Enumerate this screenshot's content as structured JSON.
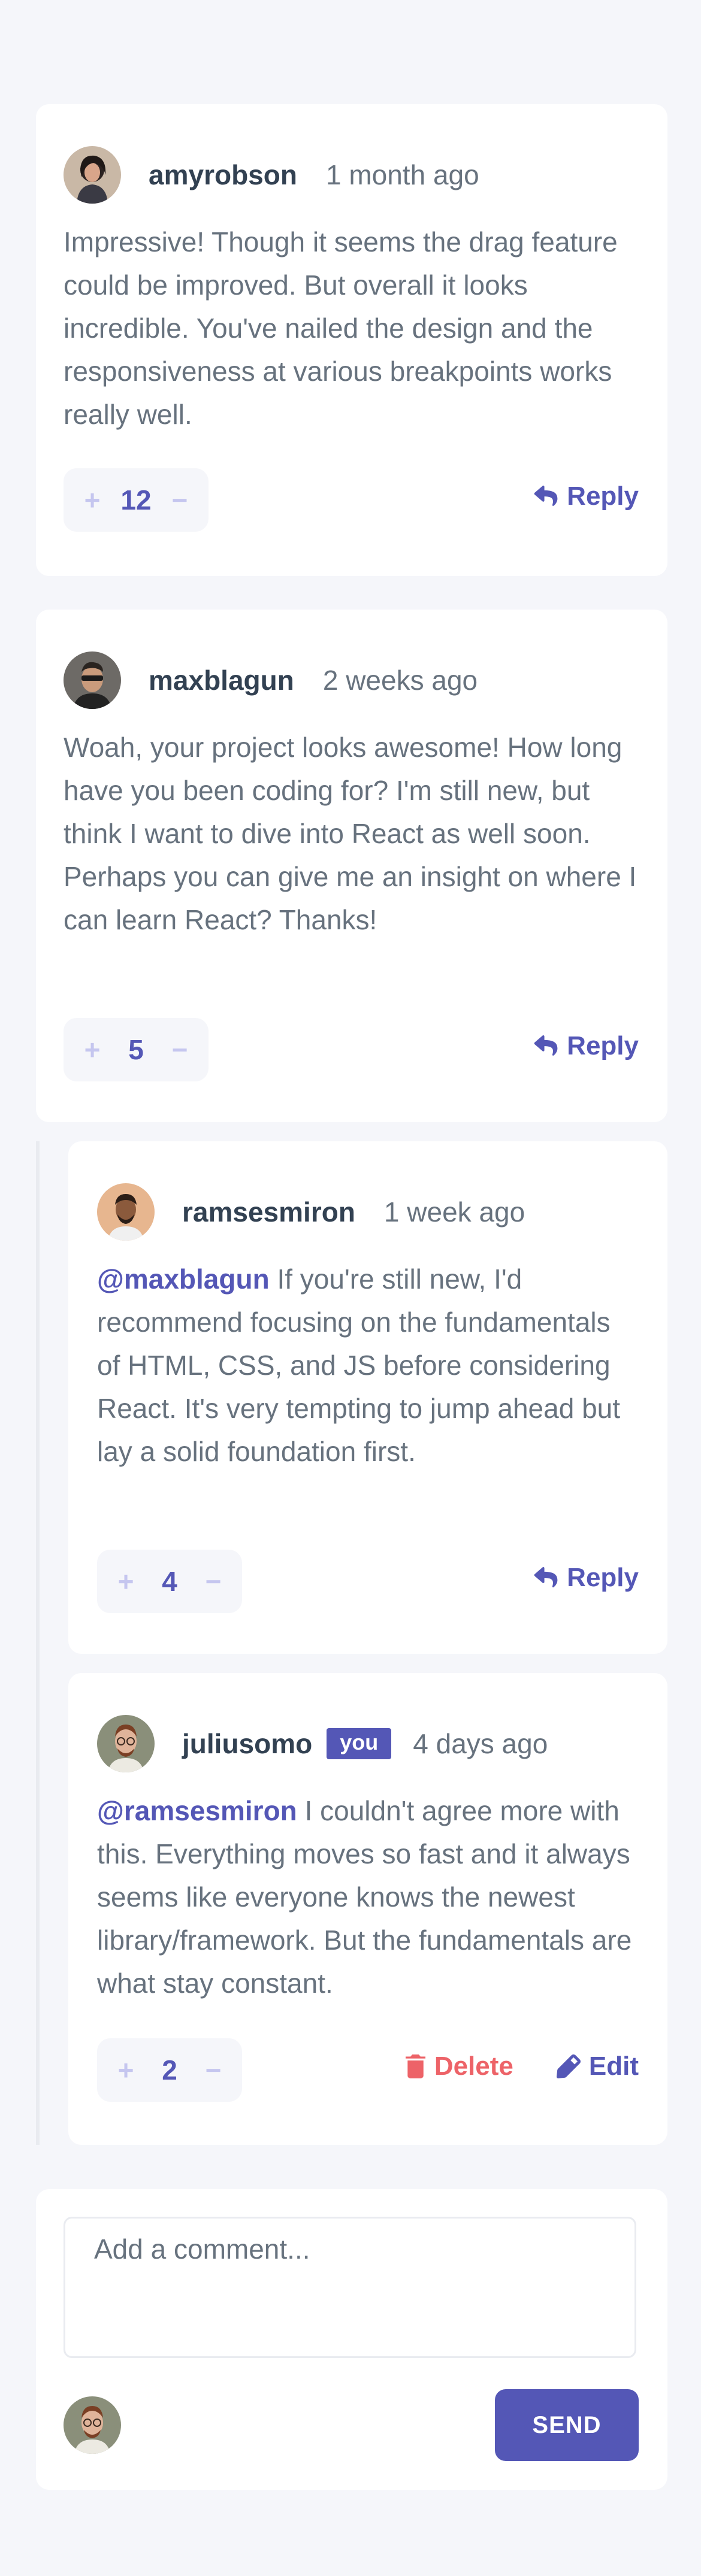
{
  "comments": [
    {
      "username": "amyrobson",
      "date": "1 month ago",
      "content": "Impressive! Though it seems the drag feature could be improved. But overall it looks incredible. You've nailed the design and the responsiveness at various breakpoints works really well.",
      "score": "12",
      "reply_label": "Reply"
    },
    {
      "username": "maxblagun",
      "date": "2 weeks ago",
      "content": "Woah, your project looks awesome! How long have you been coding for? I'm still new, but think I want to dive into React as well soon. Perhaps you can give me an insight on where I can learn React? Thanks!",
      "score": "5",
      "reply_label": "Reply",
      "replies": [
        {
          "username": "ramsesmiron",
          "date": "1 week ago",
          "replying_to": "@maxblagun",
          "content": "If you're still new, I'd recommend focusing on the fundamentals of HTML, CSS, and JS before considering React. It's very tempting to jump ahead but lay a solid foundation first.",
          "score": "4",
          "reply_label": "Reply"
        },
        {
          "username": "juliusomo",
          "badge": "you",
          "date": "4 days ago",
          "replying_to": "@ramsesmiron",
          "content": "I couldn't agree more with this. Everything moves so fast and it always seems like everyone knows the newest library/framework. But the fundamentals are what stay constant.",
          "score": "2",
          "delete_label": "Delete",
          "edit_label": "Edit"
        }
      ]
    }
  ],
  "composer": {
    "placeholder": "Add a comment...",
    "send_label": "SEND"
  },
  "icons": {
    "plus": "plus-icon",
    "minus": "minus-icon",
    "reply": "reply-icon",
    "delete": "trash-icon",
    "edit": "pencil-icon"
  },
  "colors": {
    "background": "#f5f6fa",
    "accent": "#5457b6",
    "accent_light": "#c5c6ef",
    "danger": "#ed6368",
    "heading": "#324152",
    "text": "#67727e"
  },
  "symbols": {
    "plus": "+",
    "minus": "−"
  }
}
